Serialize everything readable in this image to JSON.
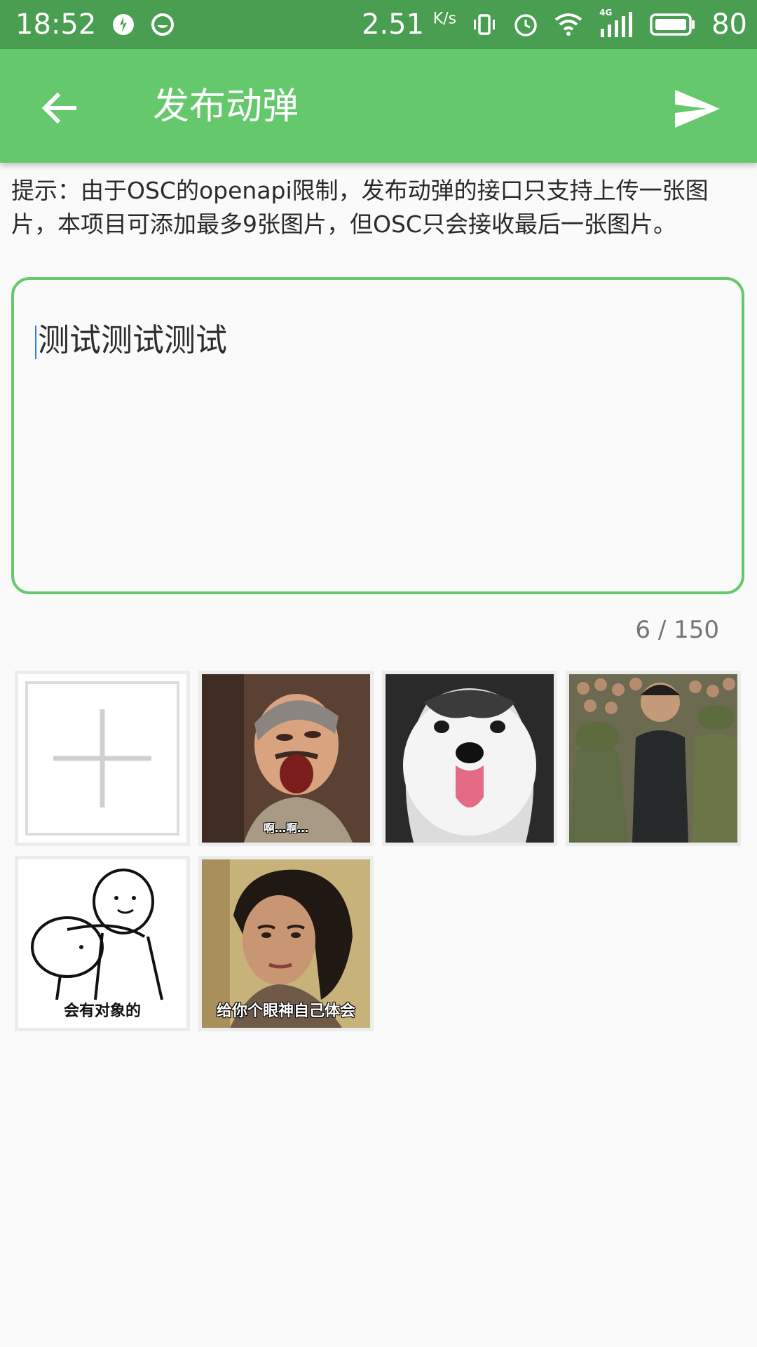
{
  "status_bar": {
    "time": "18:52",
    "net_speed": "2.51",
    "net_speed_unit": "K/s",
    "network_type": "4G",
    "battery": "80"
  },
  "app_bar": {
    "title": "发布动弹"
  },
  "tip": "提示：由于OSC的openapi限制，发布动弹的接口只支持上传一张图片，本项目可添加最多9张图片，但OSC只会接收最后一张图片。",
  "editor": {
    "value": "测试测试测试"
  },
  "counter": "6 / 150",
  "images": [
    {
      "caption": "啊…啊…"
    },
    {
      "caption": ""
    },
    {
      "caption": ""
    },
    {
      "caption": "会有对象的"
    },
    {
      "caption": "给你个眼神自己体会"
    }
  ],
  "colors": {
    "status_bar": "#4a9e51",
    "app_bar": "#66c86c",
    "accent": "#66c86c",
    "background": "#fafafa"
  }
}
